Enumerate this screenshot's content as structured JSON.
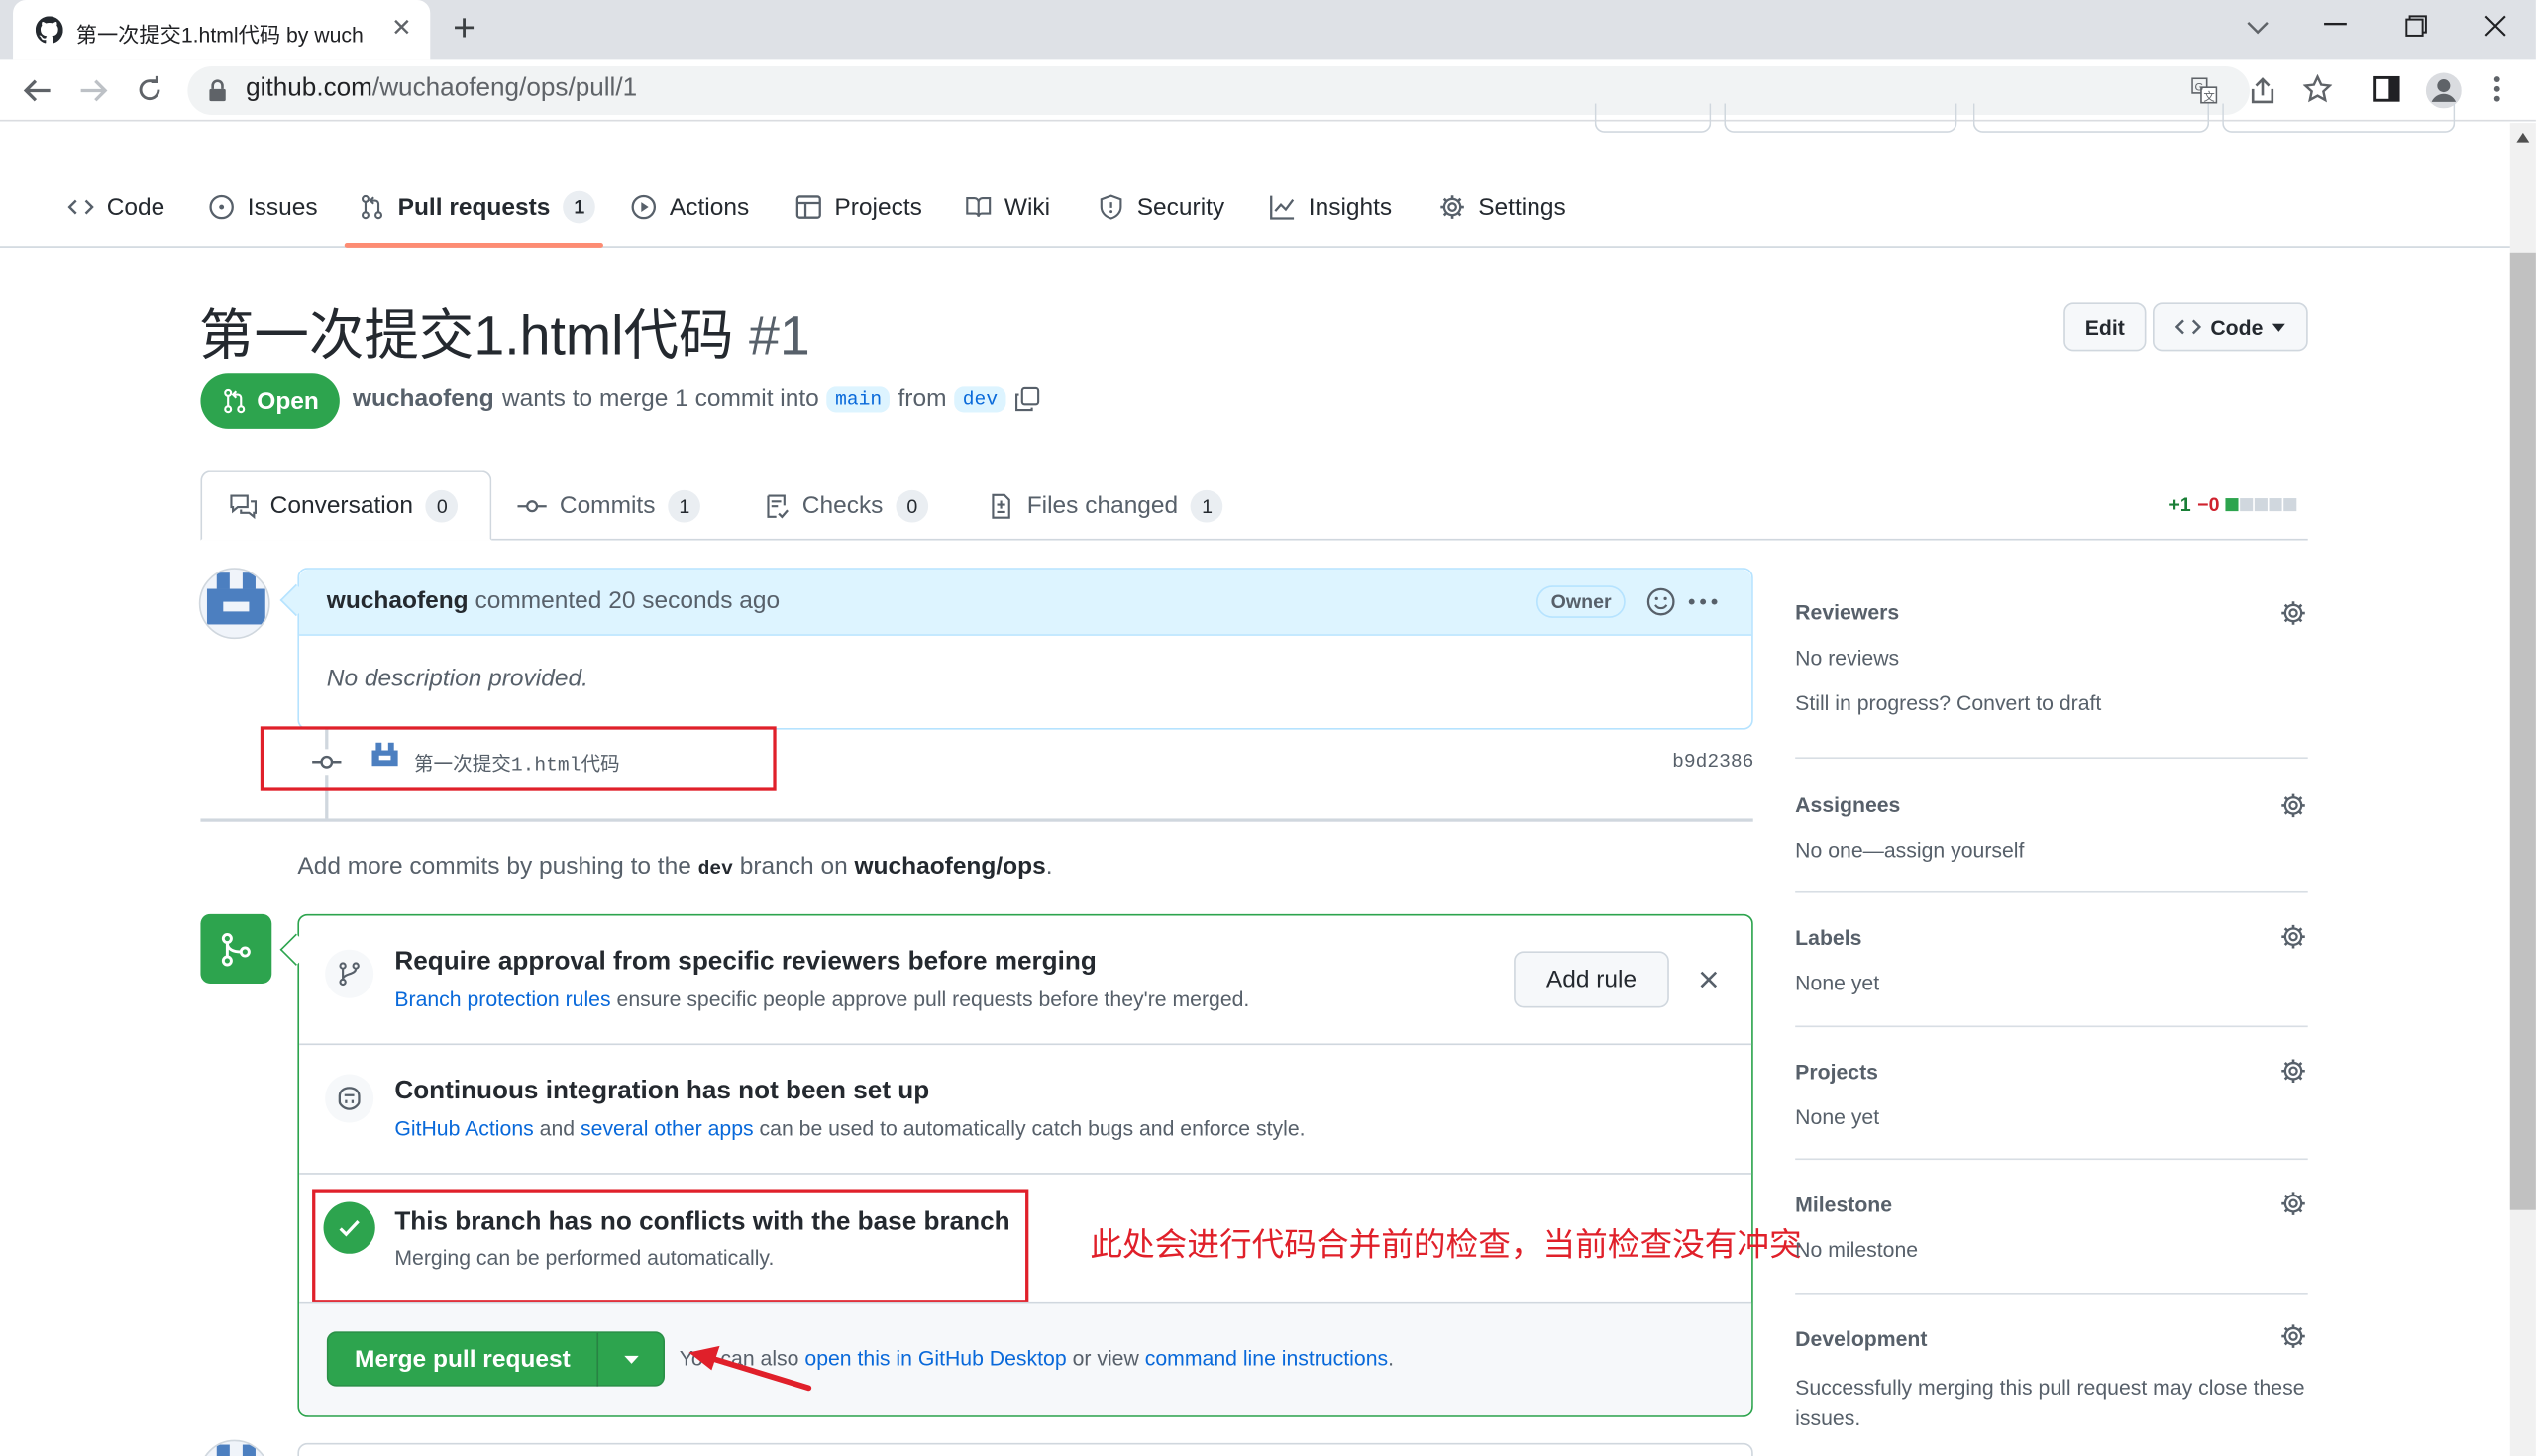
{
  "browser": {
    "tab_title": "第一次提交1.html代码 by wuch",
    "url_host": "github.com",
    "url_path": "/wuchaofeng/ops/pull/1"
  },
  "repo_nav": {
    "items": [
      {
        "label": "Code"
      },
      {
        "label": "Issues"
      },
      {
        "label": "Pull requests",
        "count": "1"
      },
      {
        "label": "Actions"
      },
      {
        "label": "Projects"
      },
      {
        "label": "Wiki"
      },
      {
        "label": "Security"
      },
      {
        "label": "Insights"
      },
      {
        "label": "Settings"
      }
    ]
  },
  "pr": {
    "title": "第一次提交1.html代码",
    "number": "#1",
    "status": "Open",
    "author": "wuchaofeng",
    "merge_text_1": "wants to merge 1 commit into",
    "base_branch": "main",
    "merge_text_2": "from",
    "head_branch": "dev",
    "edit_label": "Edit",
    "code_label": "Code"
  },
  "pr_tabs": [
    {
      "label": "Conversation",
      "count": "0"
    },
    {
      "label": "Commits",
      "count": "1"
    },
    {
      "label": "Checks",
      "count": "0"
    },
    {
      "label": "Files changed",
      "count": "1"
    }
  ],
  "diffstat": {
    "added": "+1",
    "removed": "−0"
  },
  "comment": {
    "author": "wuchaofeng",
    "action": "commented 20 seconds ago",
    "badge": "Owner",
    "body": "No description provided."
  },
  "commit": {
    "message": "第一次提交1.html代码",
    "sha": "b9d2386"
  },
  "push_hint": {
    "prefix": "Add more commits by pushing to the",
    "branch": "dev",
    "middle": "branch on",
    "repo": "wuchaofeng/ops",
    "suffix": "."
  },
  "merge_box": {
    "rule_title": "Require approval from specific reviewers before merging",
    "rule_link": "Branch protection rules",
    "rule_desc": "ensure specific people approve pull requests before they're merged.",
    "add_rule_label": "Add rule",
    "ci_title": "Continuous integration has not been set up",
    "ci_link1": "GitHub Actions",
    "ci_and": "and",
    "ci_link2": "several other apps",
    "ci_desc": "can be used to automatically catch bugs and enforce style.",
    "conflict_title": "This branch has no conflicts with the base branch",
    "conflict_desc": "Merging can be performed automatically.",
    "merge_button": "Merge pull request",
    "alt_prefix": "You can also",
    "alt_link1": "open this in GitHub Desktop",
    "alt_middle": "or view",
    "alt_link2": "command line instructions",
    "alt_suffix": "."
  },
  "annotation": {
    "text": "此处会进行代码合并前的检查，当前检查没有冲突",
    "color": "#e0202a"
  },
  "sidebar": {
    "reviewers": {
      "heading": "Reviewers",
      "value": "No reviews",
      "hint_prefix": "Still in progress?",
      "hint_link": "Convert to draft"
    },
    "assignees": {
      "heading": "Assignees",
      "value": "No one—assign yourself"
    },
    "labels": {
      "heading": "Labels",
      "value": "None yet"
    },
    "projects": {
      "heading": "Projects",
      "value": "None yet"
    },
    "milestone": {
      "heading": "Milestone",
      "value": "No milestone"
    },
    "development": {
      "heading": "Development",
      "value": "Successfully merging this pull request may close these issues."
    }
  },
  "colors": {
    "green": "#2da44e",
    "blue": "#0969da",
    "red": "#e0202a"
  }
}
